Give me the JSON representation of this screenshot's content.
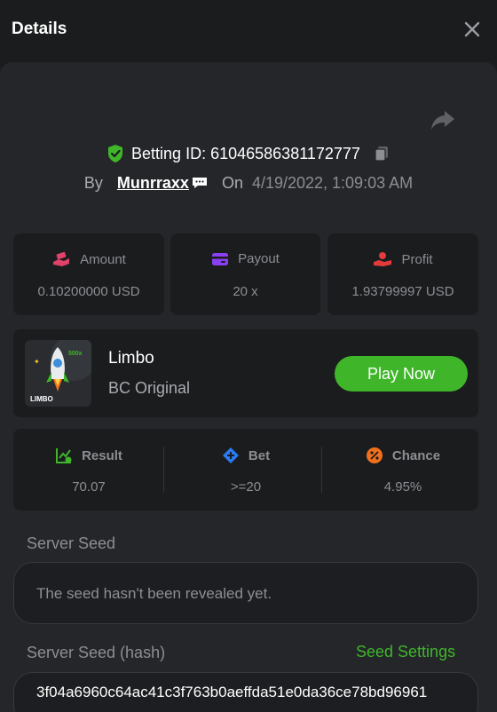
{
  "header": {
    "title": "Details"
  },
  "bet": {
    "id_label": "Betting ID:",
    "id_value": "61046586381172777",
    "by_label": "By",
    "username": "Munrraxx",
    "on_label": "On",
    "date": "4/19/2022, 1:09:03 AM"
  },
  "stats": [
    {
      "label": "Amount",
      "value": "0.10200000 USD",
      "icon": "money-hand-icon"
    },
    {
      "label": "Payout",
      "value": "20 x",
      "icon": "wallet-icon"
    },
    {
      "label": "Profit",
      "value": "1.93799997 USD",
      "icon": "coin-hand-icon"
    }
  ],
  "game": {
    "name": "Limbo",
    "subtitle": "BC Original",
    "play_label": "Play Now",
    "thumb_text": "LIMBO",
    "thumb_badge": "500x"
  },
  "results": [
    {
      "label": "Result",
      "value": "70.07",
      "icon": "chart-check-icon"
    },
    {
      "label": "Bet",
      "value": ">=20",
      "icon": "tag-icon"
    },
    {
      "label": "Chance",
      "value": "4.95%",
      "icon": "percent-icon"
    }
  ],
  "server_seed": {
    "label": "Server Seed",
    "message": "The seed hasn't been revealed yet."
  },
  "server_seed_hash": {
    "label": "Server Seed (hash)",
    "settings_label": "Seed Settings",
    "value": "3f04a6960c64ac41c3f763b0aeffda51e0da36ce78bd96961"
  },
  "colors": {
    "accent_green": "#3fb62a",
    "amount_pink": "#e0426a",
    "payout_purple": "#8a3ff2",
    "profit_red": "#e33b3b",
    "result_green": "#3fb62a",
    "bet_blue": "#2b7bf0",
    "chance_orange": "#f0701e"
  }
}
